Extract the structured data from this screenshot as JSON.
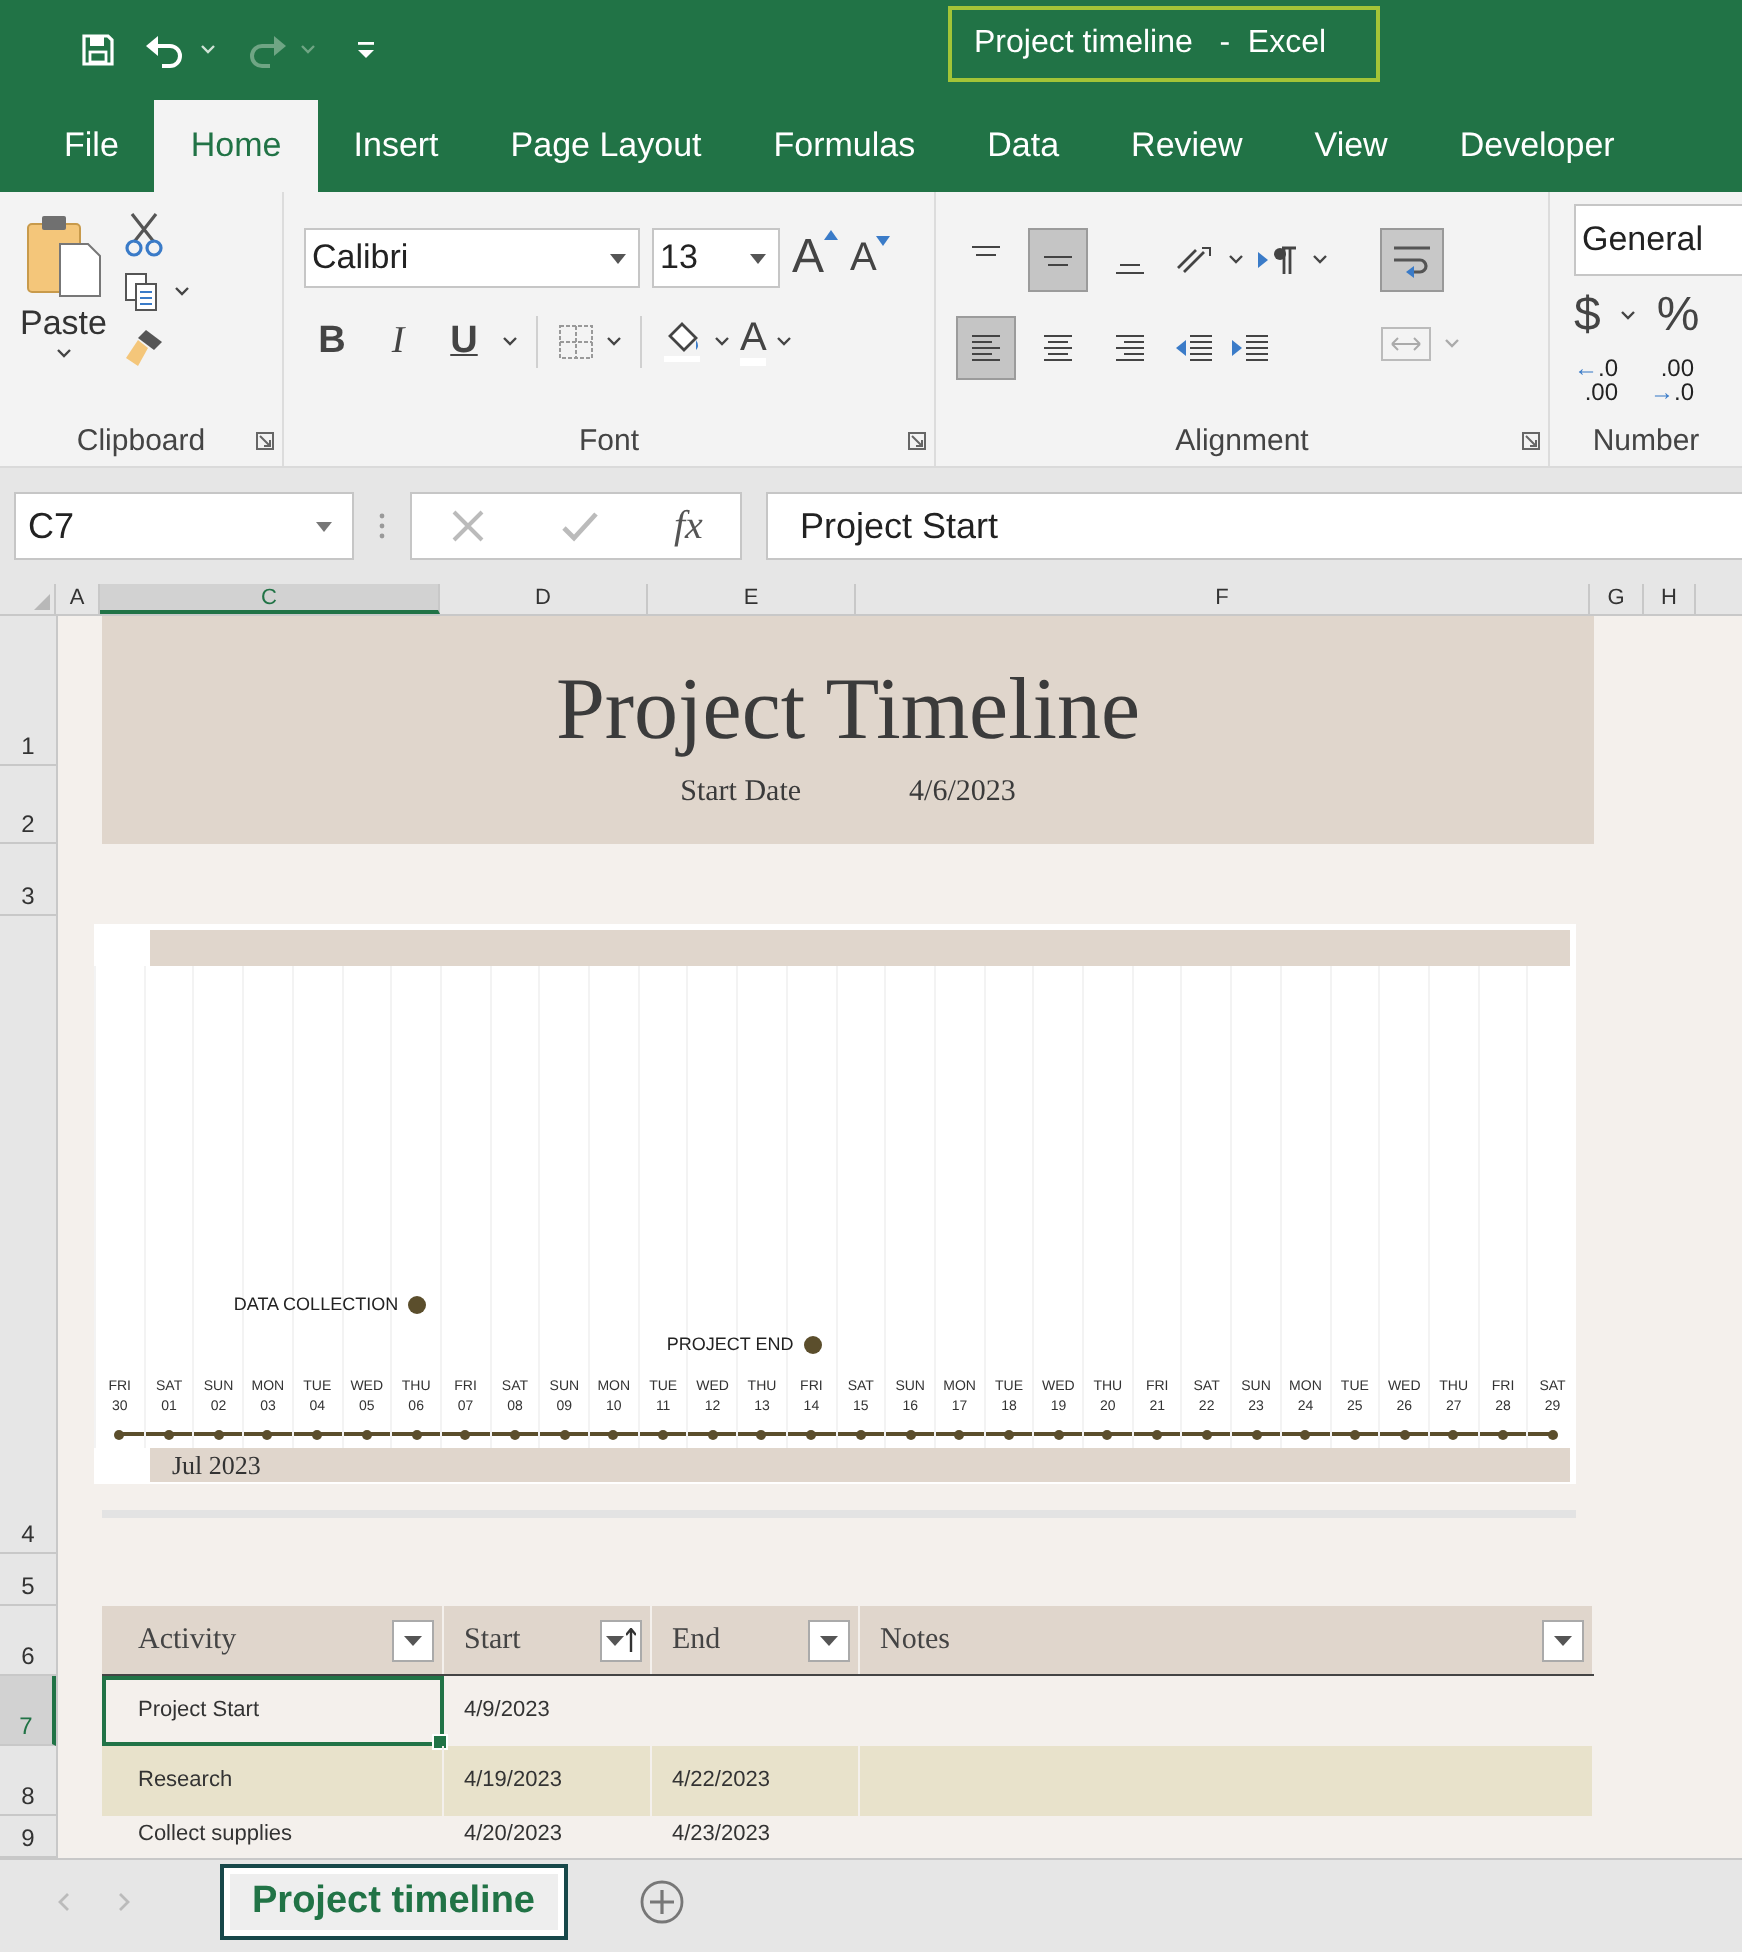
{
  "window": {
    "title": "Project timeline   -  Excel"
  },
  "ribbon_tabs": [
    {
      "label": "File",
      "selected": false
    },
    {
      "label": "Home",
      "selected": true
    },
    {
      "label": "Insert",
      "selected": false
    },
    {
      "label": "Page Layout",
      "selected": false
    },
    {
      "label": "Formulas",
      "selected": false
    },
    {
      "label": "Data",
      "selected": false
    },
    {
      "label": "Review",
      "selected": false
    },
    {
      "label": "View",
      "selected": false
    },
    {
      "label": "Developer",
      "selected": false
    }
  ],
  "ribbon": {
    "groups": [
      {
        "kind": "clipboard",
        "label": "Clipboard",
        "paste_label": "Paste"
      },
      {
        "kind": "font",
        "label": "Font",
        "font_name": "Calibri",
        "font_size": "13",
        "grow": "A",
        "shrink": "A",
        "styles": [
          "B",
          "I",
          "U"
        ],
        "font_color": "A"
      },
      {
        "kind": "alignment",
        "label": "Alignment",
        "vertical": [
          {
            "selected": false
          },
          {
            "selected": true
          },
          {
            "selected": false
          }
        ],
        "horizontal": [
          {
            "selected": true
          },
          {
            "selected": false
          },
          {
            "selected": false
          }
        ]
      },
      {
        "kind": "number",
        "label": "Number",
        "format": "General",
        "currency": "$",
        "percent": "%",
        "decimals": [
          {
            "arrow": "←",
            "top": ".0",
            "bottom": ".00"
          },
          {
            "arrow": "→",
            "top": ".00",
            "bottom": ".0"
          }
        ]
      }
    ]
  },
  "formula_bar": {
    "name_box": "C7",
    "function_label": "fx",
    "content": "Project Start"
  },
  "columns": [
    {
      "label": "A",
      "selected": false
    },
    {
      "label": "C",
      "selected": true
    },
    {
      "label": "D",
      "selected": false
    },
    {
      "label": "E",
      "selected": false
    },
    {
      "label": "F",
      "selected": false
    },
    {
      "label": "G",
      "selected": false
    },
    {
      "label": "H",
      "selected": false
    }
  ],
  "rows": [
    {
      "label": "1",
      "selected": false
    },
    {
      "label": "2",
      "selected": false
    },
    {
      "label": "3",
      "selected": false
    },
    {
      "label": "4",
      "selected": false
    },
    {
      "label": "5",
      "selected": false
    },
    {
      "label": "6",
      "selected": false
    },
    {
      "label": "7",
      "selected": true
    },
    {
      "label": "8",
      "selected": false
    },
    {
      "label": "9",
      "selected": false
    }
  ],
  "header": {
    "title": "Project Timeline",
    "start_label": "Start Date",
    "start_value": "4/6/2023"
  },
  "timeline": {
    "month_label": "Jul 2023",
    "days": [
      {
        "weekday": "FRI",
        "day": "30"
      },
      {
        "weekday": "SAT",
        "day": "01"
      },
      {
        "weekday": "SUN",
        "day": "02"
      },
      {
        "weekday": "MON",
        "day": "03"
      },
      {
        "weekday": "TUE",
        "day": "04"
      },
      {
        "weekday": "WED",
        "day": "05"
      },
      {
        "weekday": "THU",
        "day": "06",
        "milestone": {
          "label": "DATA COLLECTION"
        }
      },
      {
        "weekday": "FRI",
        "day": "07"
      },
      {
        "weekday": "SAT",
        "day": "08"
      },
      {
        "weekday": "SUN",
        "day": "09"
      },
      {
        "weekday": "MON",
        "day": "10"
      },
      {
        "weekday": "TUE",
        "day": "11"
      },
      {
        "weekday": "WED",
        "day": "12"
      },
      {
        "weekday": "THU",
        "day": "13"
      },
      {
        "weekday": "FRI",
        "day": "14",
        "milestone": {
          "label": "PROJECT END"
        }
      },
      {
        "weekday": "SAT",
        "day": "15"
      },
      {
        "weekday": "SUN",
        "day": "16"
      },
      {
        "weekday": "MON",
        "day": "17"
      },
      {
        "weekday": "TUE",
        "day": "18"
      },
      {
        "weekday": "WED",
        "day": "19"
      },
      {
        "weekday": "THU",
        "day": "20"
      },
      {
        "weekday": "FRI",
        "day": "21"
      },
      {
        "weekday": "SAT",
        "day": "22"
      },
      {
        "weekday": "SUN",
        "day": "23"
      },
      {
        "weekday": "MON",
        "day": "24"
      },
      {
        "weekday": "TUE",
        "day": "25"
      },
      {
        "weekday": "WED",
        "day": "26"
      },
      {
        "weekday": "THU",
        "day": "27"
      },
      {
        "weekday": "FRI",
        "day": "28"
      },
      {
        "weekday": "SAT",
        "day": "29"
      }
    ]
  },
  "table": {
    "columns": [
      {
        "label": "Activity",
        "sorted": false
      },
      {
        "label": "Start",
        "sorted": true
      },
      {
        "label": "End",
        "sorted": false
      },
      {
        "label": "Notes",
        "sorted": false
      }
    ],
    "rows": [
      {
        "cells": [
          "Project Start",
          "4/9/2023",
          null,
          null
        ],
        "selected": true
      },
      {
        "cells": [
          "Research",
          "4/19/2023",
          "4/22/2023",
          null
        ],
        "selected": false
      },
      {
        "cells": [
          "Collect supplies",
          "4/20/2023",
          "4/23/2023",
          null
        ],
        "selected": false
      }
    ]
  },
  "sheet_tabs": [
    {
      "label": "Project timeline",
      "selected": true
    }
  ]
}
